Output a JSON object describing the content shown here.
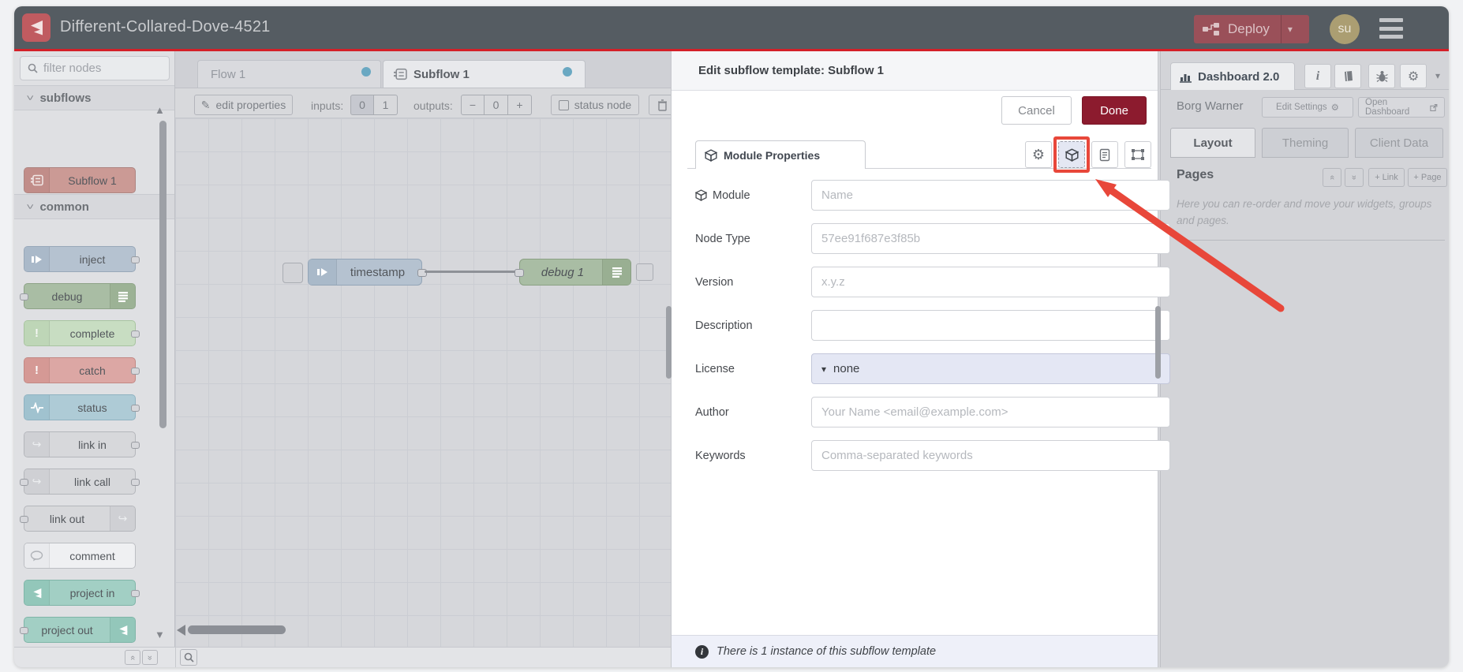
{
  "header": {
    "title": "Different-Collared-Dove-4521",
    "deploy_label": "Deploy",
    "avatar_initials": "su"
  },
  "palette": {
    "filter_placeholder": "filter nodes",
    "categories": [
      {
        "label": "subflows"
      },
      {
        "label": "common"
      }
    ],
    "subflow_nodes": [
      {
        "label": "Subflow 1"
      }
    ],
    "common_nodes": [
      {
        "label": "inject"
      },
      {
        "label": "debug"
      },
      {
        "label": "complete"
      },
      {
        "label": "catch"
      },
      {
        "label": "status"
      },
      {
        "label": "link in"
      },
      {
        "label": "link call"
      },
      {
        "label": "link out"
      },
      {
        "label": "comment"
      },
      {
        "label": "project in"
      },
      {
        "label": "project out"
      }
    ]
  },
  "workspace": {
    "tabs": [
      {
        "label": "Flow 1"
      },
      {
        "label": "Subflow 1"
      }
    ],
    "toolbar": {
      "edit_properties": "edit properties",
      "inputs_label": "inputs:",
      "input_options": [
        "0",
        "1"
      ],
      "outputs_label": "outputs:",
      "output_controls": [
        "−",
        "0",
        "+"
      ],
      "status_node_label": "status node"
    },
    "nodes": [
      {
        "label": "timestamp"
      },
      {
        "label": "debug 1"
      }
    ]
  },
  "dialog": {
    "title": "Edit subflow template: Subflow 1",
    "cancel_label": "Cancel",
    "done_label": "Done",
    "tab_label": "Module Properties",
    "form": {
      "rows": [
        {
          "label": "Module",
          "placeholder": "Name"
        },
        {
          "label": "Node Type",
          "placeholder": "57ee91f687e3f85b"
        },
        {
          "label": "Version",
          "placeholder": "x.y.z"
        },
        {
          "label": "Description",
          "placeholder": ""
        },
        {
          "label": "License",
          "value": "none"
        },
        {
          "label": "Author",
          "placeholder": "Your Name <email@example.com>"
        },
        {
          "label": "Keywords",
          "placeholder": "Comma-separated keywords"
        }
      ]
    },
    "footer_text": "There is 1 instance of this subflow template"
  },
  "sidebar": {
    "tab_label": "Dashboard 2.0",
    "project_name": "Borg Warner",
    "edit_settings_label": "Edit Settings",
    "open_dashboard_label": "Open Dashboard",
    "tabs": [
      {
        "label": "Layout"
      },
      {
        "label": "Theming"
      },
      {
        "label": "Client Data"
      }
    ],
    "pages": {
      "heading": "Pages",
      "link_button": "Link",
      "page_button": "Page",
      "hint": "Here you can re-order and move your widgets, groups and pages."
    }
  },
  "icons": {
    "gear": "⚙",
    "pencil": "✎",
    "caret_down": "▾",
    "chevron": ">",
    "double_chevron": "«",
    "plus": "+",
    "triangle_up": "▲",
    "triangle_down": "▼",
    "info": "i",
    "link_arrow": "↪"
  },
  "colors": {
    "header_bg": "#555c62",
    "brand_logo": "#c05b60",
    "deploy_red": "#9a5059",
    "accent_red_line": "#d42028",
    "done_button": "#8c1b2e",
    "annotation_red": "#e8473a",
    "active_tab_dot": "#6aa8c2",
    "inject_node": "#b5c2d0",
    "debug_node": "#a9bda4",
    "subflow_node": "#cb9a95",
    "project_node": "#a2cfc4",
    "license_field_bg": "#e4e7f4",
    "dialog_footer_bg": "#eef0f9"
  }
}
